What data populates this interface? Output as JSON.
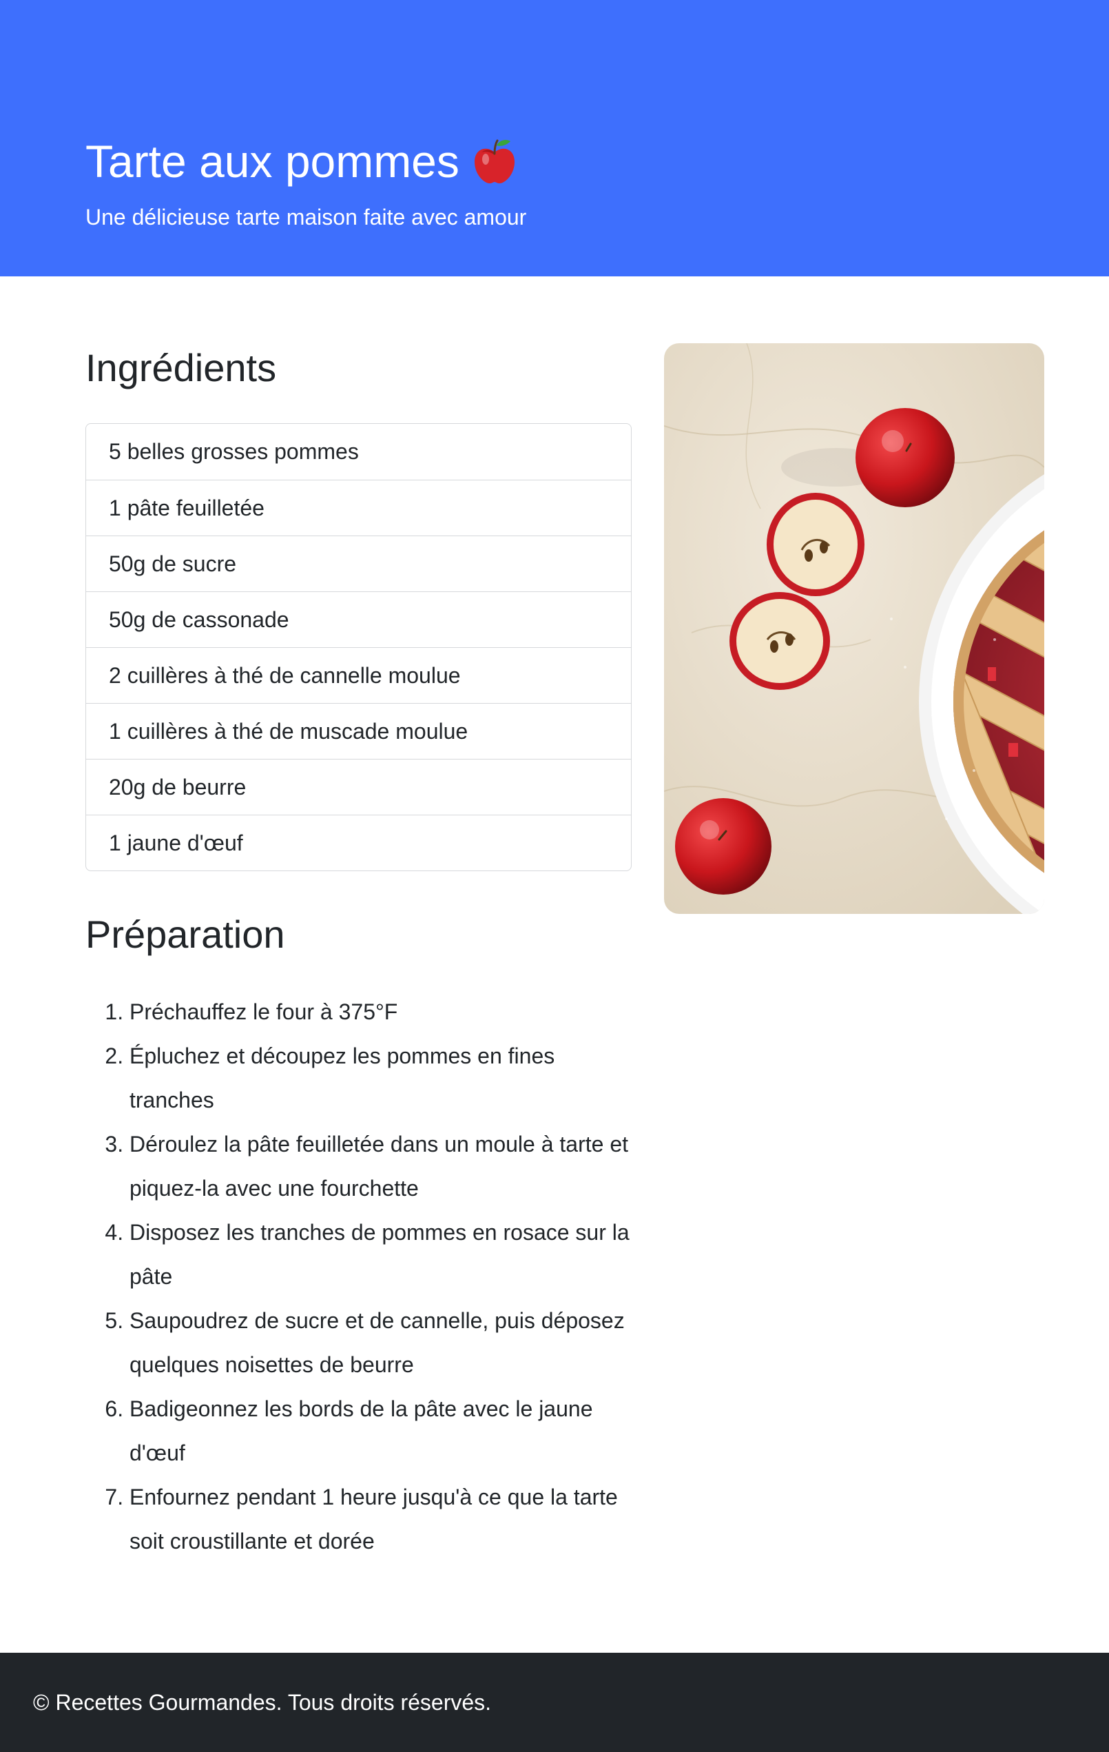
{
  "hero": {
    "title": "Tarte aux pommes",
    "title_icon": "red-apple-icon",
    "subtitle": "Une délicieuse tarte maison faite avec amour",
    "background_color": "#3e6ffd"
  },
  "ingredients": {
    "heading": "Ingrédients",
    "items": [
      "5 belles grosses pommes",
      "1 pâte feuilletée",
      "50g de sucre",
      "50g de cassonade",
      "2 cuillères à thé de cannelle moulue",
      "1 cuillères à thé de muscade moulue",
      "20g de beurre",
      "1 jaune d'œuf"
    ]
  },
  "preparation": {
    "heading": "Préparation",
    "steps": [
      "Préchauffez le four à 375°F",
      "Épluchez et découpez les pommes en fines tranches",
      "Déroulez la pâte feuilletée dans un moule à tarte et piquez-la avec une fourchette",
      "Disposez les tranches de pommes en rosace sur la pâte",
      "Saupoudrez de sucre et de cannelle, puis déposez quelques noisettes de beurre",
      "Badigeonnez les bords de la pâte avec le jaune d'œuf",
      "Enfournez pendant 1 heure jusqu'à ce que la tarte soit croustillante et dorée"
    ]
  },
  "footer": {
    "text": "© Recettes Gourmandes. Tous droits réservés.",
    "background_color": "#212529"
  }
}
